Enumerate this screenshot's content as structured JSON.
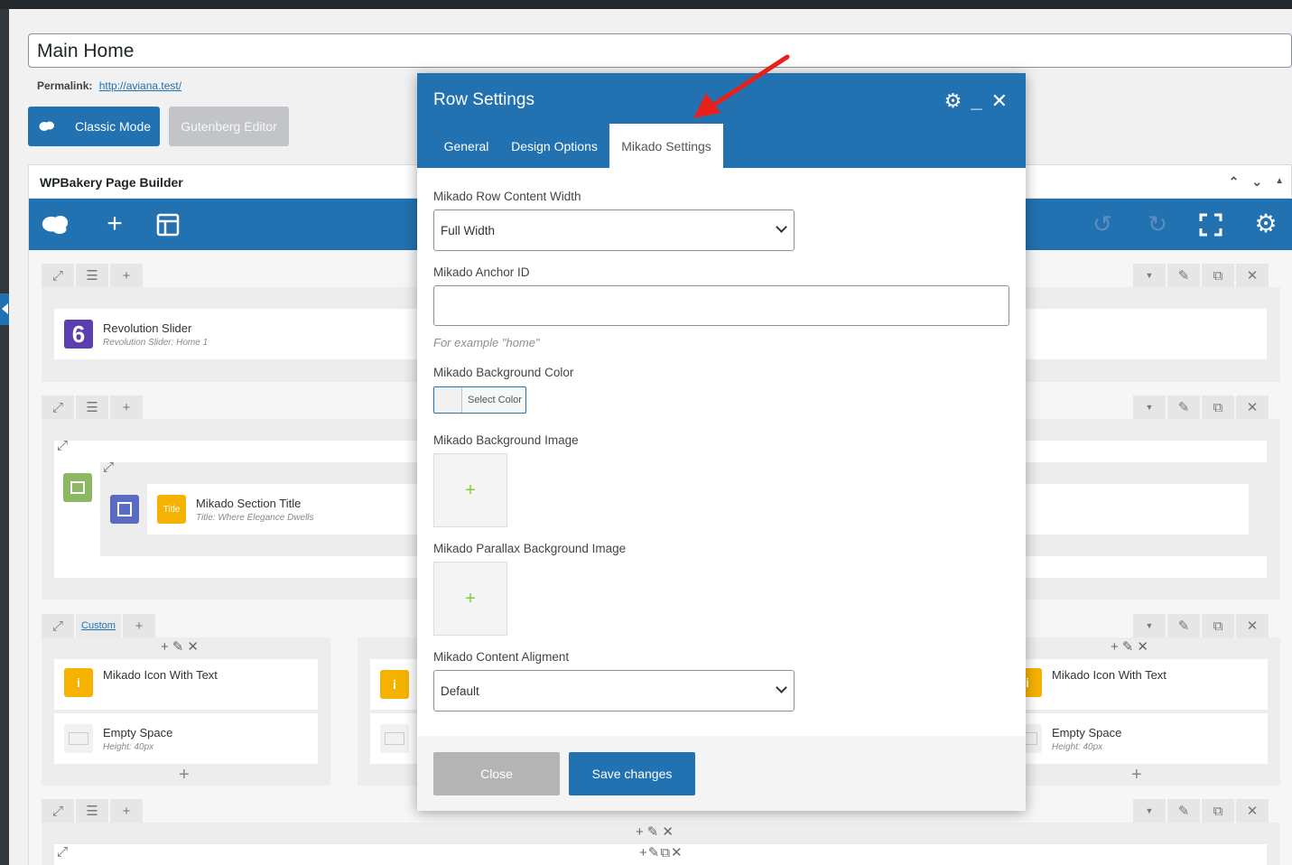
{
  "page": {
    "title_value": "Main Home",
    "permalink_label": "Permalink:",
    "permalink_url": "http://aviana.test/",
    "classic_mode_label": "Classic Mode",
    "gutenberg_label": "Gutenberg Editor"
  },
  "builder": {
    "title": "WPBakery Page Builder",
    "header_controls": [
      "^",
      "v",
      "▲"
    ],
    "nav_icons": [
      "wpb-logo-icon",
      "add-element-icon",
      "templates-icon",
      "undo-icon",
      "redo-icon",
      "fullscreen-icon",
      "settings-icon"
    ],
    "custom_label": "Custom",
    "elements": {
      "rev_slider": {
        "name": "Revolution Slider",
        "sub": "Revolution Slider: Home 1",
        "badge": "6"
      },
      "section_title": {
        "name": "Mikado Section Title",
        "sub": "Title: Where Elegance Dwells",
        "badge": "Title"
      },
      "icon_text_left": {
        "name": "Mikado Icon With Text",
        "badge": "i"
      },
      "empty_space_left": {
        "name": "Empty Space",
        "sub": "Height: 40px"
      },
      "icon_text_right": {
        "name": "Mikado Icon With Text",
        "badge": "i"
      },
      "empty_space_right": {
        "name": "Empty Space",
        "sub": "Height: 40px"
      }
    }
  },
  "dialog": {
    "title": "Row Settings",
    "tabs": [
      "General",
      "Design Options",
      "Mikado Settings"
    ],
    "active_tab": "Mikado Settings",
    "fields": {
      "content_width_label": "Mikado Row Content Width",
      "content_width_value": "Full Width",
      "anchor_label": "Mikado Anchor ID",
      "anchor_value": "",
      "anchor_help": "For example \"home\"",
      "bg_color_label": "Mikado Background Color",
      "select_color": "Select Color",
      "bg_image_label": "Mikado Background Image",
      "parallax_label": "Mikado Parallax Background Image",
      "alignment_label": "Mikado Content Aligment",
      "alignment_value": "Default"
    },
    "buttons": {
      "close": "Close",
      "save": "Save changes"
    }
  },
  "colors": {
    "accent": "#2271b1",
    "arrow": "#e8201c",
    "rev_badge": "#5b3fb0",
    "title_badge": "#f5b200",
    "row_badge": "#8cb863",
    "column_badge": "#5a6bc4"
  }
}
